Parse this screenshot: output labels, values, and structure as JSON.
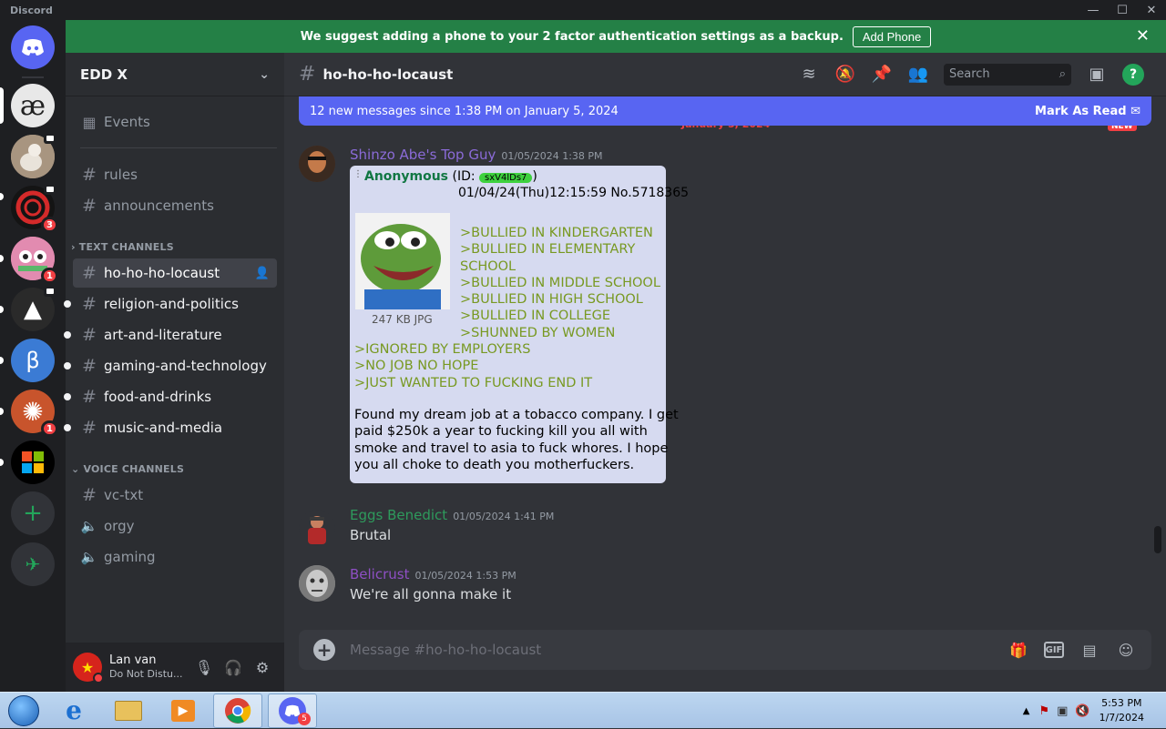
{
  "window": {
    "app_name": "Discord",
    "min": "—",
    "max": "☐",
    "close": "✕"
  },
  "banner": {
    "text": "We suggest adding a phone to your 2 factor authentication settings as a backup.",
    "button": "Add Phone"
  },
  "server_rail": {
    "items": [
      {
        "name": "home",
        "glyph": "◉",
        "color": "#5865f2"
      },
      {
        "name": "ae-server",
        "glyph": "æ",
        "color": "#e8e8e8"
      },
      {
        "name": "cat-server",
        "glyph": "",
        "color": "#b39b84"
      },
      {
        "name": "red-ring-server",
        "glyph": "◐",
        "color": "#1a1a1a",
        "badge": "3"
      },
      {
        "name": "colorful-server",
        "glyph": "",
        "color": "#d86a9a",
        "badge": "1"
      },
      {
        "name": "mountain-server",
        "glyph": "▲",
        "color": "#2a2a2a"
      },
      {
        "name": "beta-server",
        "glyph": "β",
        "color": "#3b7bd4"
      },
      {
        "name": "wheel-server",
        "glyph": "✺",
        "color": "#c8542c",
        "badge": "1"
      },
      {
        "name": "windows-server",
        "glyph": "",
        "color": "#000000"
      }
    ],
    "add_glyph": "+",
    "discover_glyph": "✈"
  },
  "sidebar": {
    "server_name": "EDD X",
    "events": "Events",
    "text_category": "TEXT CHANNELS",
    "voice_category": "VOICE CHANNELS",
    "top_channels": [
      "rules",
      "announcements"
    ],
    "text_channels": [
      "ho-ho-ho-locaust",
      "religion-and-politics",
      "art-and-literature",
      "gaming-and-technology",
      "food-and-drinks",
      "music-and-media"
    ],
    "voice_channels": [
      "vc-txt",
      "orgy",
      "gaming"
    ]
  },
  "user": {
    "name": "Lan van",
    "status": "Do Not Distu..."
  },
  "chat": {
    "channel": "ho-ho-ho-locaust",
    "search_placeholder": "Search",
    "new_messages": "12 new messages since 1:38 PM on January 5, 2024",
    "mark_read": "Mark As Read",
    "date_divider": "January 5, 2024",
    "new_label": "NEW",
    "composer_placeholder": "Message #ho-ho-ho-locaust"
  },
  "messages": [
    {
      "author": "Shinzo Abe's Top Guy",
      "color": "#8b6bd8",
      "time": "01/05/2024 1:38 PM"
    },
    {
      "author": "Eggs Benedict",
      "color": "#2e9a5c",
      "time": "01/05/2024 1:41 PM",
      "text": "Brutal"
    },
    {
      "author": "Belicrust",
      "color": "#8e4fc4",
      "time": "01/05/2024 1:53 PM",
      "text": "We're all gonna make it"
    }
  ],
  "post": {
    "anon": "Anonymous",
    "id_label": "(ID: ",
    "id_value": "sxV4lDs7",
    "id_close": ")",
    "date": "01/04/24(Thu)12:15:59 No.5718365",
    "file_info": "247 KB JPG",
    "lines_right": [
      ">BULLIED IN KINDERGARTEN",
      ">BULLIED IN ELEMENTARY",
      "SCHOOL",
      ">BULLIED IN MIDDLE SCHOOL",
      ">BULLIED IN HIGH SCHOOL",
      ">BULLIED IN COLLEGE",
      ">SHUNNED BY WOMEN"
    ],
    "lines_full": [
      ">IGNORED BY EMPLOYERS",
      ">NO JOB NO HOPE",
      ">JUST WANTED TO FUCKING END IT"
    ],
    "body": [
      "Found my dream job at a tobacco company. I get",
      "paid $250k a year to fucking kill you all with",
      "smoke and travel to asia to fuck whores. I hope",
      "you all choke to death you motherfuckers."
    ]
  },
  "taskbar": {
    "time": "5:53 PM",
    "date": "1/7/2024",
    "discord_badge": "5"
  }
}
